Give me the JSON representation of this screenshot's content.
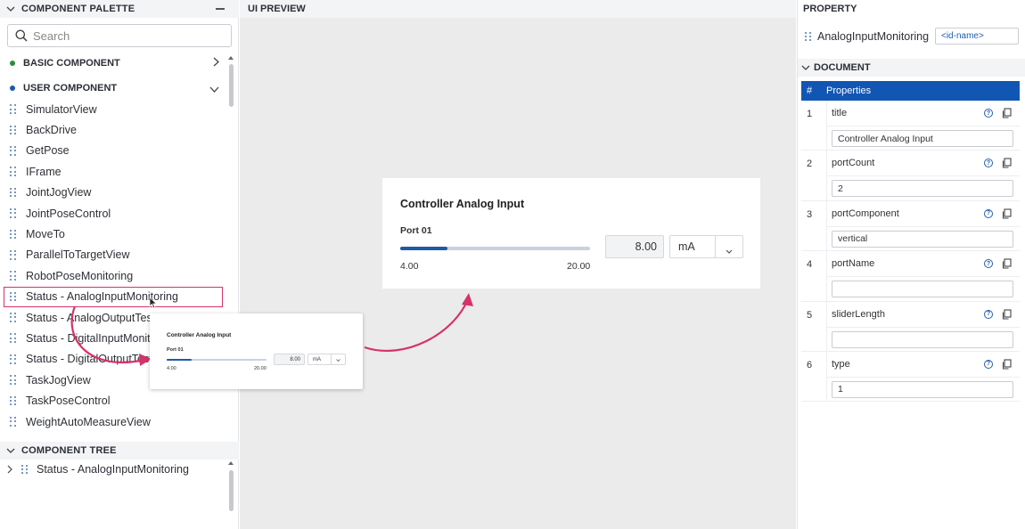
{
  "palette": {
    "header": "COMPONENT PALETTE",
    "search_placeholder": "Search",
    "basic": {
      "label": "BASIC COMPONENT",
      "color": "#2e8b3a"
    },
    "user": {
      "label": "USER COMPONENT",
      "color": "#1e5aa8"
    },
    "items": [
      "SimulatorView",
      "BackDrive",
      "GetPose",
      "IFrame",
      "JointJogView",
      "JointPoseControl",
      "MoveTo",
      "ParallelToTargetView",
      "RobotPoseMonitoring",
      "Status - AnalogInputMonitoring",
      "Status - AnalogOutputTest",
      "Status - DigitalInputMonitoring",
      "Status - DigitalOutputTest",
      "TaskJogView",
      "TaskPoseControl",
      "WeightAutoMeasureView"
    ]
  },
  "tree": {
    "header": "COMPONENT TREE",
    "item": "Status - AnalogInputMonitoring"
  },
  "preview": {
    "header": "UI PREVIEW",
    "card": {
      "title": "Controller Analog Input",
      "port": "Port 01",
      "min": "4.00",
      "max": "20.00",
      "value": "8.00",
      "unit": "mA",
      "fill_fraction": 0.25
    },
    "drag_card": {
      "title": "Controller Analog Input",
      "port": "Port 01",
      "min": "4.00",
      "max": "20.00",
      "value": "8.00",
      "unit": "mA"
    },
    "arrow_color": "#d5336a"
  },
  "property": {
    "header": "PROPERTY",
    "component_name": "AnalogInputMonitoring",
    "id_placeholder": "<id-name>",
    "document_header": "DOCUMENT",
    "table_header_num": "#",
    "table_header_props": "Properties",
    "rows": [
      {
        "num": "1",
        "name": "title",
        "value": "Controller Analog Input"
      },
      {
        "num": "2",
        "name": "portCount",
        "value": "2"
      },
      {
        "num": "3",
        "name": "portComponent",
        "value": "vertical"
      },
      {
        "num": "4",
        "name": "portName",
        "value": ""
      },
      {
        "num": "5",
        "name": "sliderLength",
        "value": ""
      },
      {
        "num": "6",
        "name": "type",
        "value": "1"
      }
    ]
  }
}
